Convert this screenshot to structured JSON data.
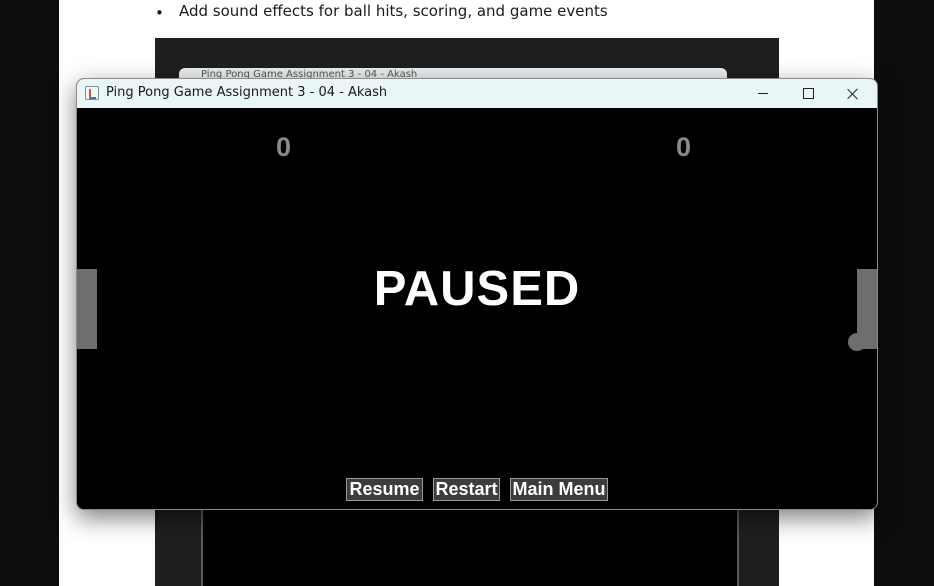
{
  "document": {
    "bullet_symbol": "•",
    "bullet_text": "Add sound effects for ball hits, scoring, and game events",
    "background_window_title": "Ping Pong Game Assignment 3 - 04 - Akash"
  },
  "window": {
    "title": "Ping Pong Game Assignment 3 - 04 - Akash",
    "controls": [
      "minimize",
      "maximize",
      "close"
    ]
  },
  "game": {
    "score_left": "0",
    "score_right": "0",
    "status_text": "PAUSED",
    "buttons": {
      "resume": "Resume",
      "restart": "Restart",
      "main_menu": "Main Menu"
    },
    "colors": {
      "background": "#000000",
      "paddle": "#6e6e6e",
      "score": "#8a8a8a",
      "button_bg": "#3c3c3c"
    }
  }
}
